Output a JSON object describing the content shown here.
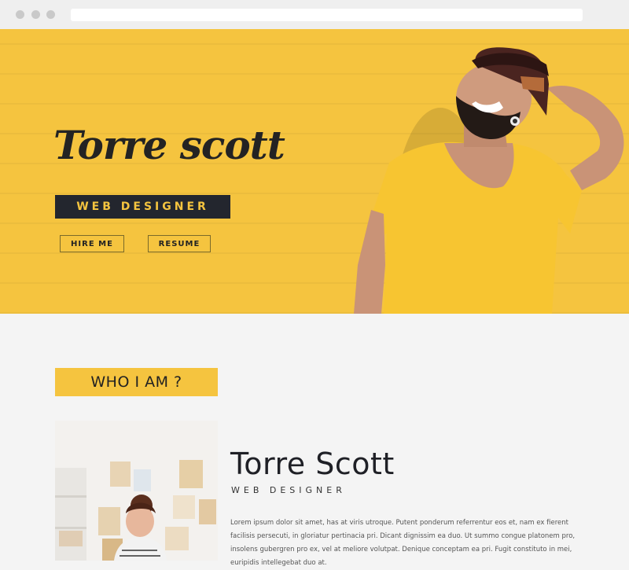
{
  "browser": {
    "window_controls": [
      "close",
      "minimize",
      "maximize"
    ],
    "address_value": ""
  },
  "hero": {
    "title": "Torre scott",
    "role": "WEB DESIGNER",
    "hire_label": "HIRE ME",
    "resume_label": "RESUME"
  },
  "about": {
    "heading": "WHO I AM ?",
    "name": "Torre Scott",
    "subtitle": "WEB DESIGNER",
    "paragraph": "Lorem ipsum dolor sit amet, has at viris utroque. Putent ponderum referrentur eos et, nam ex fierent facilisis persecuti, in gloriatur pertinacia pri. Dicant dignissim ea duo. Ut summo congue platonem pro, insolens gubergren pro ex, vel at meliore volutpat. Denique conceptam ea pri. Fugit constituto in mei, euripidis intellegebat duo at."
  },
  "colors": {
    "accent": "#f5c43f",
    "dark": "#23262e"
  }
}
